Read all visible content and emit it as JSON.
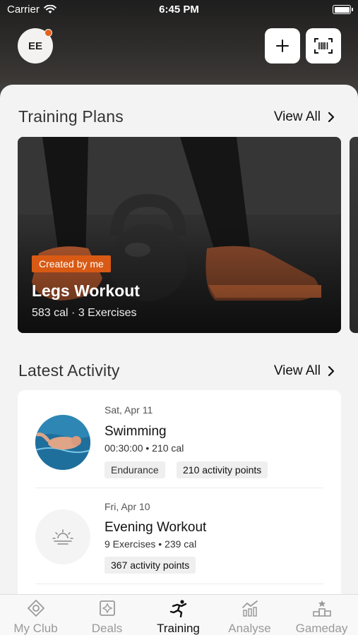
{
  "status": {
    "carrier": "Carrier",
    "time": "6:45 PM"
  },
  "header": {
    "avatar_initials": "EE"
  },
  "training_plans": {
    "title": "Training Plans",
    "view_all": "View All",
    "card": {
      "badge": "Created by me",
      "title": "Legs Workout",
      "meta": "583 cal · 3 Exercises"
    }
  },
  "latest_activity": {
    "title": "Latest Activity",
    "view_all": "View All",
    "items": [
      {
        "date": "Sat, Apr 11",
        "name": "Swimming",
        "meta": "00:30:00 • 210 cal",
        "tags": [
          "Endurance",
          "210 activity points"
        ]
      },
      {
        "date": "Fri, Apr 10",
        "name": "Evening Workout",
        "meta": "9 Exercises • 239 cal",
        "tags": [
          "367 activity points"
        ]
      }
    ]
  },
  "tabbar": {
    "tabs": [
      {
        "label": "My Club",
        "icon": "club-icon"
      },
      {
        "label": "Deals",
        "icon": "deals-icon"
      },
      {
        "label": "Training",
        "icon": "training-runner-icon"
      },
      {
        "label": "Analyse",
        "icon": "analyse-chart-icon"
      },
      {
        "label": "Gameday",
        "icon": "gameday-podium-icon"
      }
    ],
    "active_index": 2
  },
  "colors": {
    "accent": "#d85a14",
    "notification_dot": "#e8601c"
  }
}
